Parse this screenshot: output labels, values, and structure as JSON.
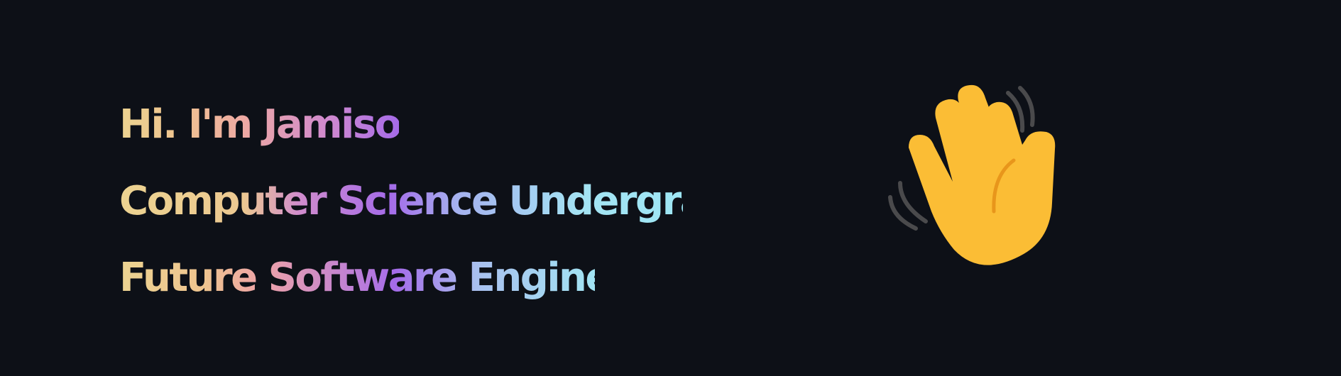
{
  "hero": {
    "greeting": "Hi. I'm Jamison.",
    "role": "Computer Science Undergrad.",
    "aspiration": "Future Software Engineer."
  },
  "icons": {
    "wave": "waving-hand-icon"
  },
  "colors": {
    "background": "#0d1017",
    "gradient_warm": "#ecd391",
    "gradient_pink": "#eea9a4",
    "gradient_purple": "#a46be9",
    "gradient_cyan": "#a4e3f3",
    "hand": "#fbbd35",
    "hand_crease": "#e8961b",
    "motion_lines": "#4a4a4c"
  }
}
